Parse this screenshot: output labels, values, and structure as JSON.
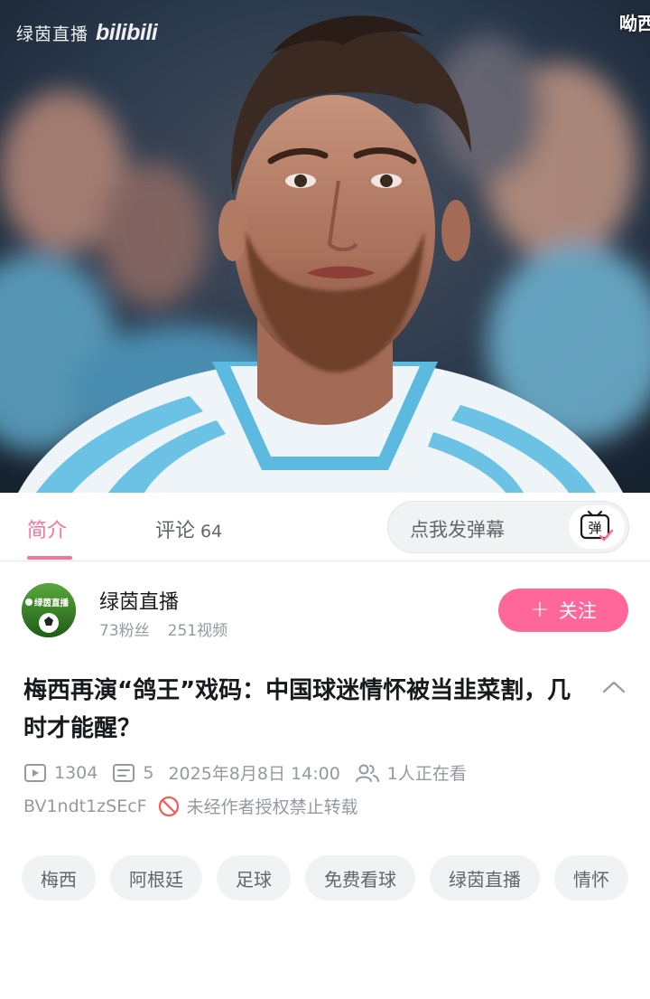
{
  "player": {
    "watermark_channel": "绿茵直播",
    "watermark_logo": "bilibili",
    "top_right_text": "呦西"
  },
  "tabs": {
    "intro": "简介",
    "comments": "评论",
    "comments_count": "64"
  },
  "danmaku": {
    "placeholder": "点我发弹幕",
    "button_glyph": "弹"
  },
  "uploader": {
    "name": "绿茵直播",
    "avatar_text": "绿茵直播",
    "fans": "73粉丝",
    "videos": "251视频",
    "follow_label": "关注",
    "follow_plus": "+"
  },
  "video": {
    "title": "梅西再演“鸽王”戏码：中国球迷情怀被当韭菜割，几时才能醒？",
    "views": "1304",
    "danmaku_count": "5",
    "publish_time": "2025年8月8日 14:00",
    "watching": "1人正在看",
    "bvid": "BV1ndt1zSEcF",
    "copyright_notice": "未经作者授权禁止转载"
  },
  "tags": [
    "梅西",
    "阿根廷",
    "足球",
    "免费看球",
    "绿茵直播",
    "情怀"
  ],
  "colors": {
    "accent_pink": "#fb7299",
    "follow_pink": "#ff6699",
    "muted_text": "#9499a0",
    "tag_bg": "#f1f2f3"
  },
  "icons": [
    "play-count-icon",
    "danmaku-count-icon",
    "watching-users-icon",
    "no-reprint-icon",
    "collapse-chevron-icon",
    "danmaku-send-icon"
  ]
}
